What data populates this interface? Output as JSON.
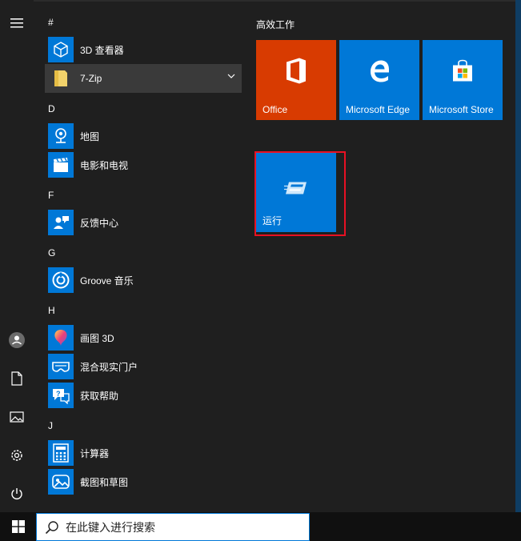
{
  "rail": {
    "icons": [
      "menu-icon",
      "user-icon",
      "documents-icon",
      "pictures-icon",
      "settings-icon",
      "power-icon"
    ]
  },
  "app_list": {
    "sections": [
      {
        "letter": "#"
      },
      {
        "letter": "D"
      },
      {
        "letter": "F"
      },
      {
        "letter": "G"
      },
      {
        "letter": "H"
      },
      {
        "letter": "J"
      }
    ],
    "apps": [
      {
        "label": "3D 查看器",
        "icon": "3d-viewer-icon"
      },
      {
        "label": "7-Zip",
        "icon": "folder-icon",
        "expandable": true
      },
      {
        "label": "地图",
        "icon": "maps-icon"
      },
      {
        "label": "电影和电视",
        "icon": "movies-icon"
      },
      {
        "label": "反馈中心",
        "icon": "feedback-icon"
      },
      {
        "label": "Groove 音乐",
        "icon": "groove-icon"
      },
      {
        "label": "画图 3D",
        "icon": "paint3d-icon"
      },
      {
        "label": "混合现实门户",
        "icon": "mixed-reality-icon"
      },
      {
        "label": "获取帮助",
        "icon": "help-icon"
      },
      {
        "label": "计算器",
        "icon": "calculator-icon"
      },
      {
        "label": "截图和草图",
        "icon": "snip-sketch-icon"
      }
    ]
  },
  "tiles": {
    "group_title": "高效工作",
    "items": [
      {
        "label": "Office",
        "color": "#d83b01",
        "icon": "office-icon"
      },
      {
        "label": "Microsoft Edge",
        "color": "#0078d7",
        "icon": "edge-icon"
      },
      {
        "label": "Microsoft Store",
        "color": "#0078d7",
        "icon": "store-icon"
      },
      {
        "label": "运行",
        "color": "#0078d7",
        "icon": "run-icon",
        "highlighted": true
      }
    ]
  },
  "taskbar": {
    "search_placeholder": "在此键入进行搜索"
  },
  "colors": {
    "accent": "#0078d7",
    "office": "#d83b01",
    "highlight_border": "#e81123",
    "background": "#1f1f1f"
  }
}
